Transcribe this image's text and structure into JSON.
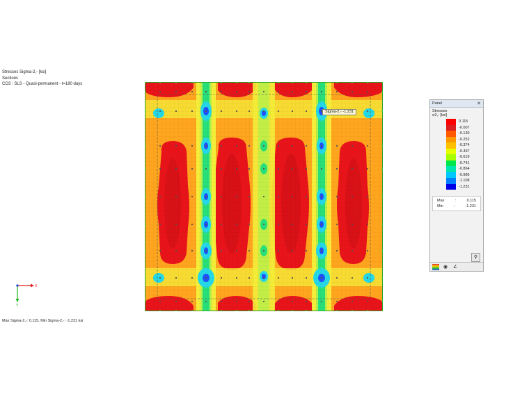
{
  "header": {
    "line1": "Stresses Sigma-2,- [ksi]",
    "line2": "Sections",
    "line3": "CO3 : SLS - Quasi-permanent - t=180 days"
  },
  "tooltip": {
    "text": "Sigma-2,-  -1.231"
  },
  "footer": {
    "text": "Max Sigma-2,-: 0.115, Min Sigma-2,-: -1.231 ksi"
  },
  "axes": {
    "x_label": "X",
    "y_label": "Y"
  },
  "panel": {
    "title": "Panel",
    "close": "✕",
    "section": "Stresses",
    "quantity": "σ2,- [ksi]",
    "legend": [
      {
        "value": "0.115",
        "color": "#ff0000"
      },
      {
        "value": "-0.007",
        "color": "#dc1d1d"
      },
      {
        "value": "-0.130",
        "color": "#ff5a00"
      },
      {
        "value": "-0.252",
        "color": "#ff9900"
      },
      {
        "value": "-0.374",
        "color": "#ffc000"
      },
      {
        "value": "-0.497",
        "color": "#e6ff00"
      },
      {
        "value": "-0.619",
        "color": "#a8ff00"
      },
      {
        "value": "-0.741",
        "color": "#00e64d"
      },
      {
        "value": "-0.864",
        "color": "#00e6b0"
      },
      {
        "value": "-0.986",
        "color": "#00c8ff"
      },
      {
        "value": "-1.108",
        "color": "#0080ff"
      },
      {
        "value": "-1.231",
        "color": "#0000e6"
      }
    ],
    "max_label": "Max",
    "max_value": "0.115",
    "min_label": "Min",
    "min_value": "-1.231",
    "sep": ":"
  },
  "colors": {
    "red": "#e8141a",
    "orange": "#ffa51e",
    "yellow": "#f4ee3a",
    "lightgreen": "#b6f04a",
    "green": "#28e07a",
    "cyan": "#24d8e6",
    "blue": "#2050ff",
    "darkblue": "#101cc0"
  }
}
